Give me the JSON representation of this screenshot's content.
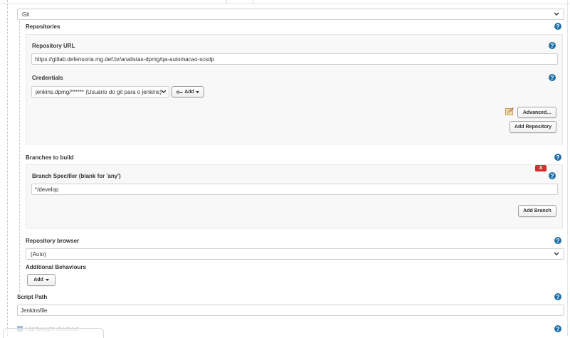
{
  "scm": {
    "selected": "Git"
  },
  "repositories": {
    "heading": "Repositories",
    "url_label": "Repository URL",
    "url_value": "https://gitlab.defensoria.mg.def.br/analistas-dpmg/qa-automacao-scsdp",
    "credentials_label": "Credentials",
    "credentials_selected": "jenkins.dpmg/****** (Usuário do git para o jenkins)",
    "add_credentials_label": "Add",
    "advanced_label": "Advanced...",
    "add_repository_label": "Add Repository"
  },
  "branches": {
    "heading": "Branches to build",
    "specifier_label": "Branch Specifier (blank for 'any')",
    "specifier_value": "*/develop",
    "delete_label": "X",
    "add_branch_label": "Add Branch"
  },
  "repo_browser": {
    "label": "Repository browser",
    "selected": "(Auto)"
  },
  "behaviours": {
    "label": "Additional Behaviours",
    "add_label": "Add"
  },
  "script_path": {
    "label": "Script Path",
    "value": "Jenkinsfile"
  },
  "lightweight": {
    "label": "Lightweight checkout"
  },
  "colors": {
    "help": "#1f6fa8",
    "delete": "#d32f2f"
  }
}
